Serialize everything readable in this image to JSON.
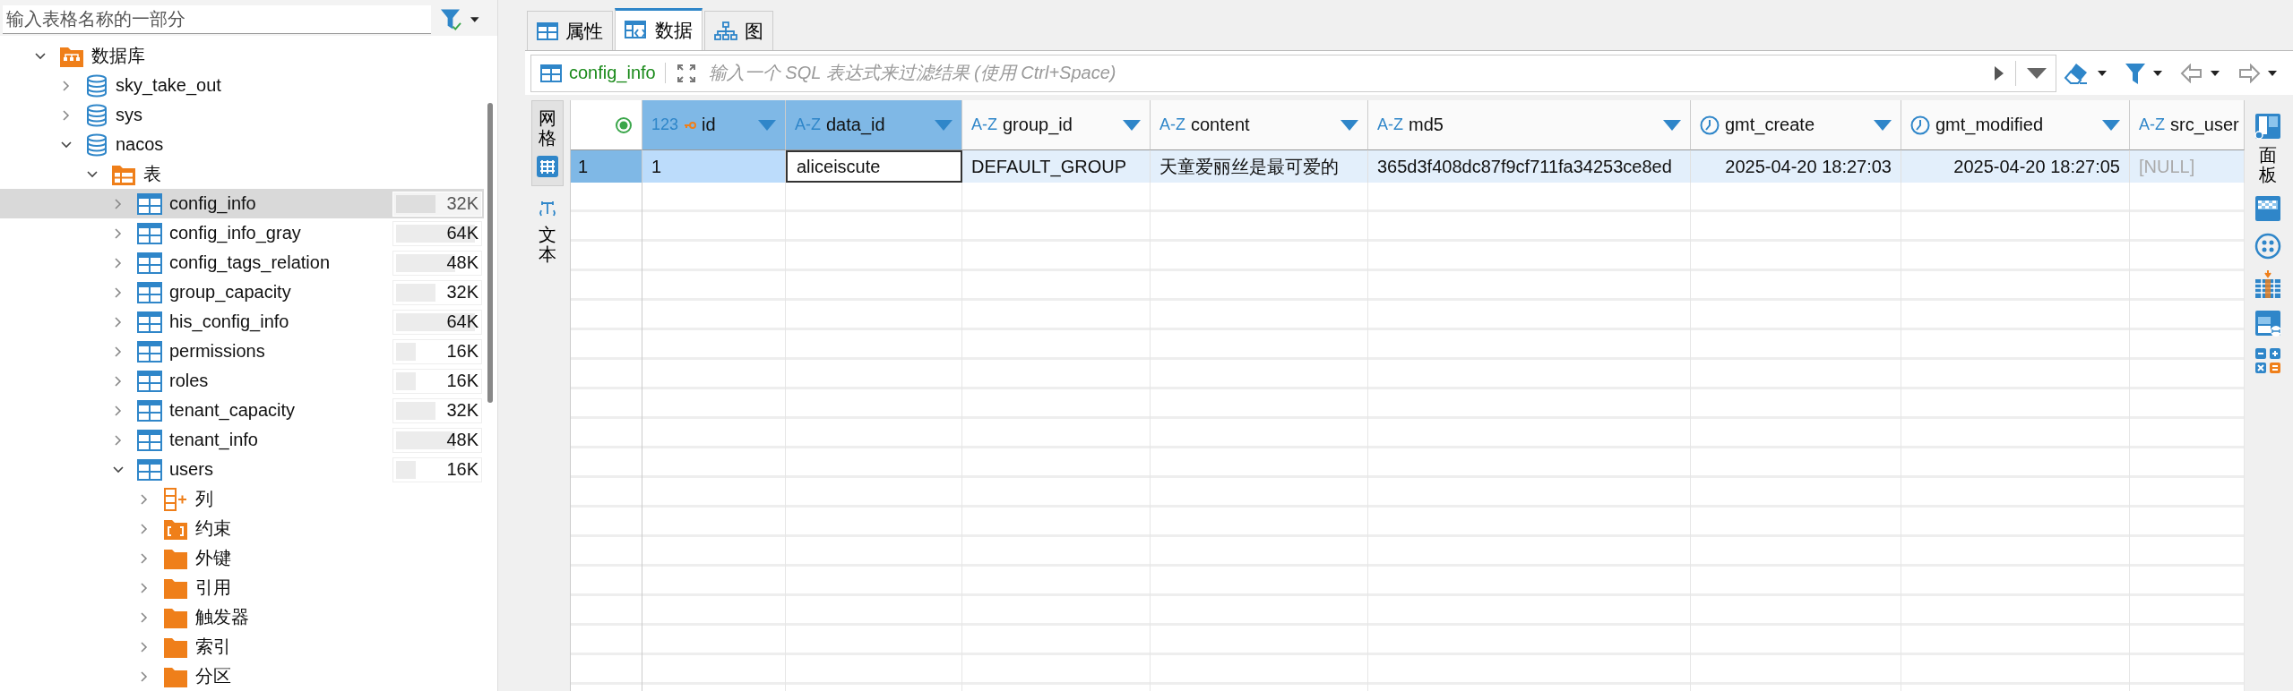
{
  "navigator": {
    "search": {
      "placeholder": "输入表格名称的一部分"
    },
    "tree": [
      {
        "label": "数据库",
        "kind": "db-folder",
        "expanded": true,
        "selected": false,
        "children": [
          {
            "label": "sky_take_out",
            "kind": "database",
            "expanded": false,
            "selected": false
          },
          {
            "label": "sys",
            "kind": "database",
            "expanded": false,
            "selected": false
          },
          {
            "label": "nacos",
            "kind": "database",
            "expanded": true,
            "selected": false,
            "children": [
              {
                "label": "表",
                "kind": "table-folder",
                "expanded": true,
                "selected": false,
                "children": [
                  {
                    "label": "config_info",
                    "kind": "table",
                    "expanded": false,
                    "selected": true,
                    "size": "32K",
                    "level": 0.5
                  },
                  {
                    "label": "config_info_gray",
                    "kind": "table",
                    "expanded": false,
                    "selected": false,
                    "size": "64K",
                    "level": 1
                  },
                  {
                    "label": "config_tags_relation",
                    "kind": "table",
                    "expanded": false,
                    "selected": false,
                    "size": "48K",
                    "level": 0.75
                  },
                  {
                    "label": "group_capacity",
                    "kind": "table",
                    "expanded": false,
                    "selected": false,
                    "size": "32K",
                    "level": 0.5
                  },
                  {
                    "label": "his_config_info",
                    "kind": "table",
                    "expanded": false,
                    "selected": false,
                    "size": "64K",
                    "level": 1
                  },
                  {
                    "label": "permissions",
                    "kind": "table",
                    "expanded": false,
                    "selected": false,
                    "size": "16K",
                    "level": 0.25
                  },
                  {
                    "label": "roles",
                    "kind": "table",
                    "expanded": false,
                    "selected": false,
                    "size": "16K",
                    "level": 0.25
                  },
                  {
                    "label": "tenant_capacity",
                    "kind": "table",
                    "expanded": false,
                    "selected": false,
                    "size": "32K",
                    "level": 0.5
                  },
                  {
                    "label": "tenant_info",
                    "kind": "table",
                    "expanded": false,
                    "selected": false,
                    "size": "48K",
                    "level": 0.75
                  },
                  {
                    "label": "users",
                    "kind": "table",
                    "expanded": true,
                    "selected": false,
                    "size": "16K",
                    "level": 0.25,
                    "children": [
                      {
                        "label": "列",
                        "kind": "columns",
                        "expanded": false,
                        "selected": false
                      },
                      {
                        "label": "约束",
                        "kind": "constraints",
                        "expanded": false,
                        "selected": false
                      },
                      {
                        "label": "外键",
                        "kind": "folder",
                        "expanded": false,
                        "selected": false
                      },
                      {
                        "label": "引用",
                        "kind": "folder",
                        "expanded": false,
                        "selected": false
                      },
                      {
                        "label": "触发器",
                        "kind": "folder",
                        "expanded": false,
                        "selected": false
                      },
                      {
                        "label": "索引",
                        "kind": "folder",
                        "expanded": false,
                        "selected": false
                      },
                      {
                        "label": "分区",
                        "kind": "folder",
                        "expanded": false,
                        "selected": false
                      }
                    ]
                  }
                ]
              }
            ]
          }
        ]
      }
    ]
  },
  "editor_tabs": [
    {
      "label": "属性",
      "kind": "properties",
      "selected": false
    },
    {
      "label": "数据",
      "kind": "data",
      "selected": true
    },
    {
      "label": "图",
      "kind": "diagram",
      "selected": false
    }
  ],
  "filter_bar": {
    "table": "config_info",
    "placeholder": "输入一个 SQL 表达式来过滤结果 (使用 Ctrl+Space)"
  },
  "view_tabs": [
    {
      "label": "网格",
      "kind": "grid",
      "selected": true
    },
    {
      "label": "文本",
      "kind": "text",
      "selected": false
    }
  ],
  "grid": {
    "columns": [
      {
        "name": "id",
        "kind": "number",
        "type_label": "123",
        "key": true,
        "selected": true
      },
      {
        "name": "data_id",
        "kind": "text",
        "type_label": "A-Z",
        "key": false,
        "selected": true
      },
      {
        "name": "group_id",
        "kind": "text",
        "type_label": "A-Z",
        "key": false,
        "selected": false
      },
      {
        "name": "content",
        "kind": "text",
        "type_label": "A-Z",
        "key": false,
        "selected": false
      },
      {
        "name": "md5",
        "kind": "text",
        "type_label": "A-Z",
        "key": false,
        "selected": false
      },
      {
        "name": "gmt_create",
        "kind": "datetime",
        "key": false,
        "selected": false
      },
      {
        "name": "gmt_modified",
        "kind": "datetime",
        "key": false,
        "selected": false
      },
      {
        "name": "src_user",
        "kind": "text",
        "type_label": "A-Z",
        "key": false,
        "selected": false
      }
    ],
    "rows": [
      {
        "number": "1",
        "selected": true,
        "cells": [
          {
            "text": "1",
            "focused": false,
            "null": false
          },
          {
            "text": "aliceiscute",
            "focused": true,
            "null": false
          },
          {
            "text": "DEFAULT_GROUP",
            "focused": false,
            "null": false
          },
          {
            "text": "天童爱丽丝是最可爱的",
            "focused": false,
            "null": false
          },
          {
            "text": "365d3f408dc87f9cf711fa34253ce8ed",
            "focused": false,
            "null": false
          },
          {
            "text": "2025-04-20 18:27:03",
            "focused": false,
            "null": false
          },
          {
            "text": "2025-04-20 18:27:05",
            "focused": false,
            "null": false
          },
          {
            "text": "[NULL]",
            "focused": false,
            "null": true
          }
        ]
      }
    ]
  },
  "side_panel": {
    "label": "面板"
  }
}
